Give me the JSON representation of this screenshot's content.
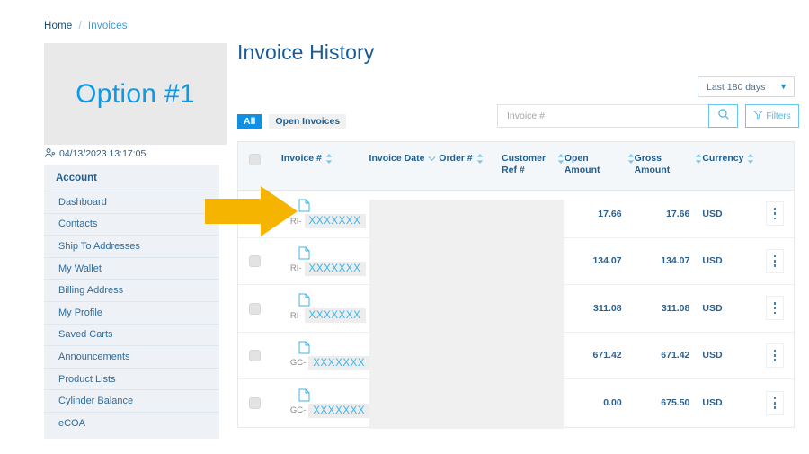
{
  "breadcrumb": {
    "home": "Home",
    "separator": "/",
    "current": "Invoices"
  },
  "annotation": {
    "option_label": "Option #1",
    "arrow_color": "#F5B400"
  },
  "user": {
    "timestamp": "04/13/2023 13:17:05",
    "icon": "user-icon"
  },
  "sidebar": {
    "heading": "Account",
    "items": [
      {
        "label": "Dashboard"
      },
      {
        "label": "Contacts"
      },
      {
        "label": "Ship To Addresses"
      },
      {
        "label": "My Wallet"
      },
      {
        "label": "Billing Address"
      },
      {
        "label": "My Profile"
      },
      {
        "label": "Saved Carts"
      },
      {
        "label": "Announcements"
      },
      {
        "label": "Product Lists"
      },
      {
        "label": "Cylinder Balance"
      },
      {
        "label": "eCOA"
      }
    ]
  },
  "main": {
    "title": "Invoice History",
    "date_range": {
      "selected": "Last 180 days",
      "icon": "chevron-down-icon"
    },
    "tabs": [
      {
        "label": "All",
        "active": true
      },
      {
        "label": "Open Invoices",
        "active": false
      }
    ],
    "search": {
      "placeholder": "Invoice #",
      "value": "",
      "icon": "search-icon"
    },
    "filters_button": {
      "label": "Filters",
      "icon": "filter-icon"
    }
  },
  "table": {
    "columns": [
      {
        "label": "Invoice #",
        "sort": "both"
      },
      {
        "label": "Invoice Date",
        "sort": "desc"
      },
      {
        "label": "Order #",
        "sort": "both"
      },
      {
        "label": "Customer Ref #",
        "sort": "both"
      },
      {
        "label": "Open Amount",
        "sort": "both"
      },
      {
        "label": "Gross Amount",
        "sort": "both"
      },
      {
        "label": "Currency",
        "sort": "both"
      }
    ],
    "rows": [
      {
        "prefix": "RI-",
        "invoice": "XXXXXXX",
        "open_amount": "17.66",
        "gross_amount": "17.66",
        "currency": "USD"
      },
      {
        "prefix": "RI-",
        "invoice": "XXXXXXX",
        "open_amount": "134.07",
        "gross_amount": "134.07",
        "currency": "USD"
      },
      {
        "prefix": "RI-",
        "invoice": "XXXXXXX",
        "open_amount": "311.08",
        "gross_amount": "311.08",
        "currency": "USD"
      },
      {
        "prefix": "GC-",
        "invoice": "XXXXXXX",
        "open_amount": "671.42",
        "gross_amount": "671.42",
        "currency": "USD"
      },
      {
        "prefix": "GC-",
        "invoice": "XXXXXXX",
        "open_amount": "0.00",
        "gross_amount": "675.50",
        "currency": "USD"
      }
    ]
  },
  "colors": {
    "accent": "#128fe0",
    "title": "#1a5c96",
    "redaction": "#f0f0f0"
  }
}
